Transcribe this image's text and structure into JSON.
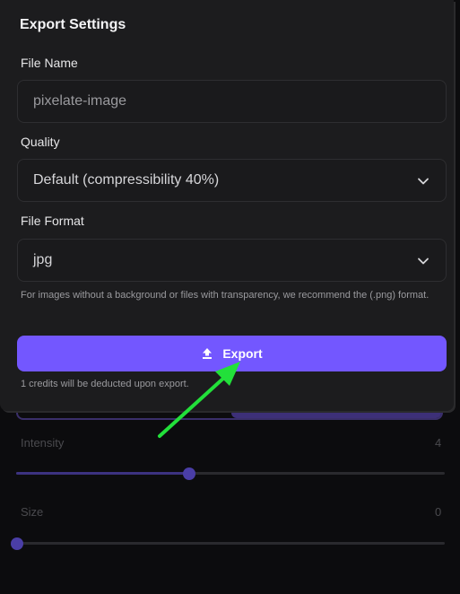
{
  "dialog": {
    "title": "Export Settings",
    "file_name": {
      "label": "File Name",
      "value": "pixelate-image"
    },
    "quality": {
      "label": "Quality",
      "selected": "Default (compressibility 40%)"
    },
    "file_format": {
      "label": "File Format",
      "selected": "jpg"
    },
    "hint": "For images without a background or files with transparency, we recommend the (.png) format.",
    "export_button": {
      "label": "Export",
      "icon": "upload-icon"
    },
    "credits_note": "1 credits will be deducted upon export."
  },
  "background_panel": {
    "intensity": {
      "label": "Intensity",
      "value": "4",
      "level_fraction": 0.41
    },
    "size": {
      "label": "Size",
      "value": "0",
      "level_fraction": 0.0
    }
  },
  "annotation": {
    "arrow_color": "#22e03a"
  },
  "colors": {
    "accent": "#7357ff",
    "dialog_bg": "#1c1c1e",
    "page_bg": "#0c0c0e"
  }
}
